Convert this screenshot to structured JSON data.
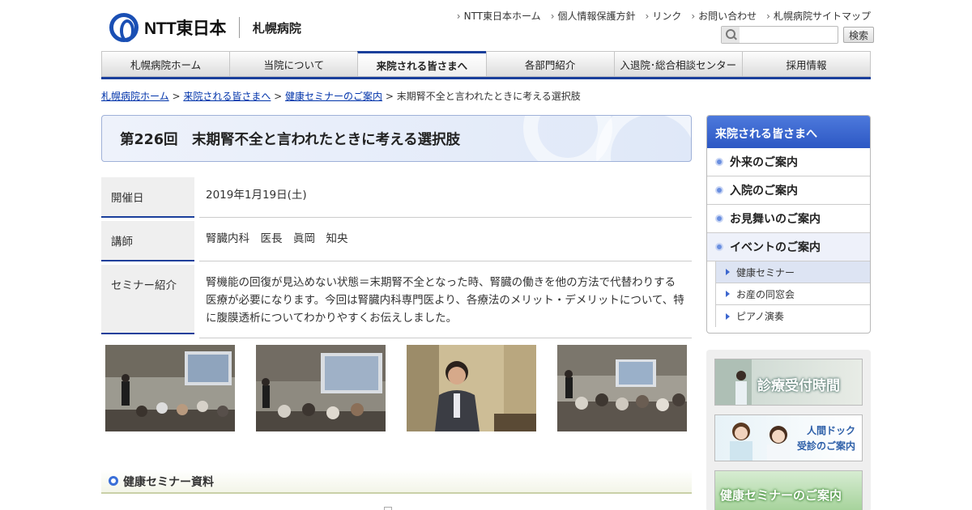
{
  "header": {
    "logo_text": "NTT東日本",
    "logo_sub": "札幌病院",
    "util_links": [
      "NTT東日本ホーム",
      "個人情報保護方針",
      "リンク",
      "お問い合わせ",
      "札幌病院サイトマップ"
    ],
    "search_placeholder": "",
    "search_button": "検索"
  },
  "gnav": [
    {
      "label": "札幌病院ホーム",
      "active": false
    },
    {
      "label": "当院について",
      "active": false
    },
    {
      "label": "来院される皆さまへ",
      "active": true
    },
    {
      "label": "各部門紹介",
      "active": false
    },
    {
      "label": "入退院･総合相談センター",
      "active": false
    },
    {
      "label": "採用情報",
      "active": false
    }
  ],
  "breadcrumb": {
    "links": [
      "札幌病院ホーム",
      "来院される皆さまへ",
      "健康セミナーのご案内"
    ],
    "current": "末期腎不全と言われたときに考える選択肢"
  },
  "page_title": "第226回　末期腎不全と言われたときに考える選択肢",
  "info": {
    "date_label": "開催日",
    "date_value": "2019年1月19日(土)",
    "lecturer_label": "講師",
    "lecturer_value": "腎臓内科　医長　眞岡　知央",
    "intro_label": "セミナー紹介",
    "intro_value": "腎機能の回復が見込めない状態＝末期腎不全となった時、腎臓の働きを他の方法で代替わりする医療が必要になります。今回は腎臓内科専門医より、各療法のメリット・デメリットについて、特に腹膜透析についてわかりやすくお伝えしました。"
  },
  "materials_heading": "健康セミナー資料",
  "sidebar": {
    "title": "来院される皆さまへ",
    "items": [
      {
        "label": "外来のご案内",
        "active": false
      },
      {
        "label": "入院のご案内",
        "active": false
      },
      {
        "label": "お見舞いのご案内",
        "active": false
      },
      {
        "label": "イベントのご案内",
        "active": true
      }
    ],
    "sub_items": [
      {
        "label": "健康セミナー",
        "active": true
      },
      {
        "label": "お産の同窓会",
        "active": false
      },
      {
        "label": "ピアノ演奏",
        "active": false
      }
    ]
  },
  "banners": {
    "hours": "診療受付時間",
    "dock_line1": "人間ドック",
    "dock_line2": "受診のご案内",
    "seminar": "健康セミナーのご案内"
  },
  "colors": {
    "brand_blue": "#1a3f9b",
    "link_blue": "#0033aa",
    "sidebar_head": "#2d58c4"
  }
}
